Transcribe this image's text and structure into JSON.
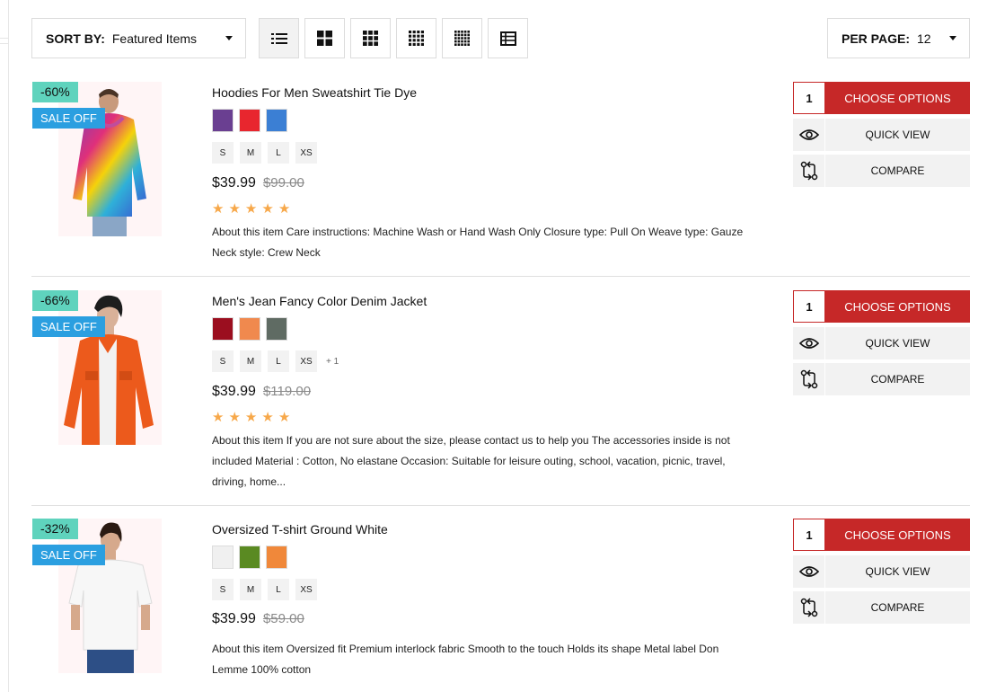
{
  "toolbar": {
    "sort_label": "SORT BY:",
    "sort_value": "Featured Items",
    "per_page_label": "PER PAGE:",
    "per_page_value": "12",
    "view_icons": [
      "list-view-icon",
      "grid-2-icon",
      "grid-3-icon",
      "grid-4-icon",
      "grid-5-icon",
      "table-view-icon"
    ],
    "active_view": "list-view-icon"
  },
  "colors": {
    "choose_options": "#c62828",
    "sale_badge": "#2b9fe0",
    "discount_badge": "#5fd3bd",
    "star": "#f7a84a"
  },
  "actions": {
    "choose_label": "CHOOSE OPTIONS",
    "quick_view_label": "QUICK VIEW",
    "compare_label": "COMPARE"
  },
  "products": [
    {
      "discount": "-60%",
      "sale": "SALE OFF",
      "title": "Hoodies For Men Sweatshirt Tie Dye",
      "swatches": [
        "#6a3f91",
        "#e8262e",
        "#3b7fd4"
      ],
      "sizes": [
        "S",
        "M",
        "L",
        "XS"
      ],
      "more_sizes": "",
      "price": "$39.99",
      "old_price": "$99.00",
      "rating": 5,
      "description": "About this item Care instructions: Machine Wash or Hand Wash Only Closure type: Pull On Weave type: Gauze Neck style: Crew Neck",
      "qty": "1"
    },
    {
      "discount": "-66%",
      "sale": "SALE OFF",
      "title": "Men's Jean Fancy Color Denim Jacket",
      "swatches": [
        "#9b0e1f",
        "#f0894e",
        "#5f6b63"
      ],
      "sizes": [
        "S",
        "M",
        "L",
        "XS"
      ],
      "more_sizes": "+ 1",
      "price": "$39.99",
      "old_price": "$119.00",
      "rating": 5,
      "description": "About this item If you are not sure about the size, please contact us to help you The accessories inside is not included Material : Cotton, No elastane Occasion: Suitable for leisure outing, school, vacation, picnic, travel, driving, home...",
      "qty": "1"
    },
    {
      "discount": "-32%",
      "sale": "SALE OFF",
      "title": "Oversized T-shirt Ground White",
      "swatches": [
        "#f0f0f0",
        "#5a8a22",
        "#f0883a"
      ],
      "sizes": [
        "S",
        "M",
        "L",
        "XS"
      ],
      "more_sizes": "",
      "price": "$39.99",
      "old_price": "$59.00",
      "rating": 0,
      "description": "About this item Oversized fit Premium interlock fabric Smooth to the touch Holds its shape Metal label Don Lemme 100% cotton",
      "qty": "1"
    }
  ]
}
